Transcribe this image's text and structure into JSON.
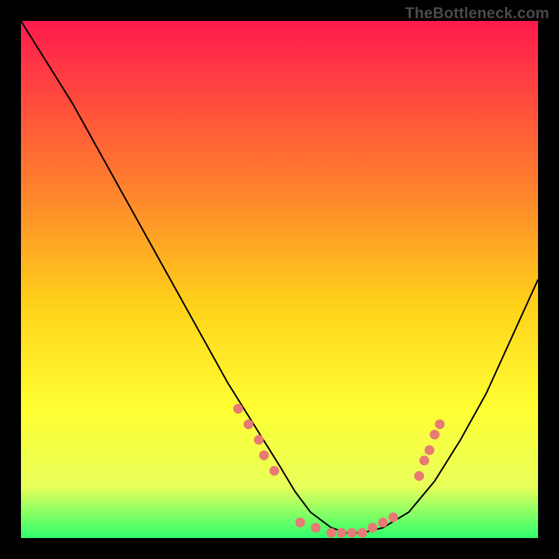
{
  "watermark": "TheBottleneck.com",
  "colors": {
    "frame": "#000000",
    "gradient_top": "#ff1a4d",
    "gradient_mid1": "#ff8a2a",
    "gradient_mid2": "#ffd21a",
    "gradient_mid3": "#ffff33",
    "gradient_mid4": "#e8ff5a",
    "gradient_bottom": "#2fff6e",
    "curve": "#000000",
    "dots": "#e77a73"
  },
  "chart_data": {
    "type": "line",
    "title": "",
    "xlabel": "",
    "ylabel": "",
    "xlim": [
      0,
      100
    ],
    "ylim": [
      0,
      100
    ],
    "grid": false,
    "annotations": [
      "TheBottleneck.com"
    ],
    "series": [
      {
        "name": "bottleneck-curve",
        "x": [
          0,
          5,
          10,
          15,
          20,
          25,
          30,
          35,
          40,
          45,
          50,
          53,
          56,
          60,
          63,
          66,
          70,
          75,
          80,
          85,
          90,
          95,
          100
        ],
        "y": [
          100,
          92,
          84,
          75,
          66,
          57,
          48,
          39,
          30,
          22,
          14,
          9,
          5,
          2,
          1,
          1,
          2,
          5,
          11,
          19,
          28,
          39,
          50
        ]
      }
    ],
    "dot_zone": {
      "name": "highlighted-points",
      "points": [
        {
          "x": 42,
          "y": 25
        },
        {
          "x": 44,
          "y": 22
        },
        {
          "x": 46,
          "y": 19
        },
        {
          "x": 47,
          "y": 16
        },
        {
          "x": 49,
          "y": 13
        },
        {
          "x": 54,
          "y": 3
        },
        {
          "x": 57,
          "y": 2
        },
        {
          "x": 60,
          "y": 1
        },
        {
          "x": 62,
          "y": 1
        },
        {
          "x": 64,
          "y": 1
        },
        {
          "x": 66,
          "y": 1
        },
        {
          "x": 68,
          "y": 2
        },
        {
          "x": 70,
          "y": 3
        },
        {
          "x": 72,
          "y": 4
        },
        {
          "x": 77,
          "y": 12
        },
        {
          "x": 78,
          "y": 15
        },
        {
          "x": 79,
          "y": 17
        },
        {
          "x": 80,
          "y": 20
        },
        {
          "x": 81,
          "y": 22
        }
      ]
    }
  }
}
